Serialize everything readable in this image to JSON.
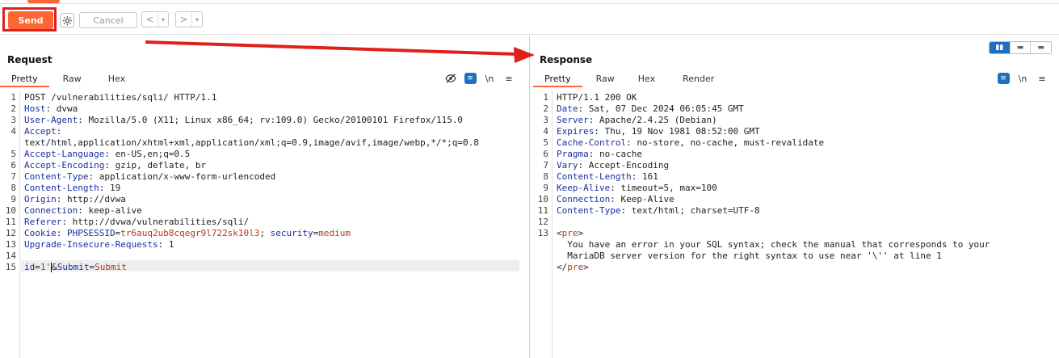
{
  "toolbar": {
    "send_label": "Send",
    "cancel_label": "Cancel",
    "back_glyph": "<",
    "forward_glyph": ">",
    "dropdown_glyph": "▾"
  },
  "request": {
    "title": "Request",
    "tabs": [
      "Pretty",
      "Raw",
      "Hex"
    ],
    "active_tab": "Pretty",
    "lines": [
      {
        "n": "1",
        "parts": [
          {
            "t": "POST /vulnerabilities/sqli/ HTTP/1.1",
            "c": "v"
          }
        ]
      },
      {
        "n": "2",
        "parts": [
          {
            "t": "Host",
            "c": "k"
          },
          {
            "t": ": dvwa",
            "c": "v"
          }
        ]
      },
      {
        "n": "3",
        "parts": [
          {
            "t": "User-Agent",
            "c": "k"
          },
          {
            "t": ": Mozilla/5.0 (X11; Linux x86_64; rv:109.0) Gecko/20100101 Firefox/115.0",
            "c": "v"
          }
        ]
      },
      {
        "n": "4",
        "parts": [
          {
            "t": "Accept",
            "c": "k"
          },
          {
            "t": ":",
            "c": "v"
          }
        ]
      },
      {
        "n": "",
        "parts": [
          {
            "t": "text/html,application/xhtml+xml,application/xml;q=0.9,image/avif,image/webp,*/*;q=0.8",
            "c": "v"
          }
        ]
      },
      {
        "n": "5",
        "parts": [
          {
            "t": "Accept-Language",
            "c": "k"
          },
          {
            "t": ": en-US,en;q=0.5",
            "c": "v"
          }
        ]
      },
      {
        "n": "6",
        "parts": [
          {
            "t": "Accept-Encoding",
            "c": "k"
          },
          {
            "t": ": gzip, deflate, br",
            "c": "v"
          }
        ]
      },
      {
        "n": "7",
        "parts": [
          {
            "t": "Content-Type",
            "c": "k"
          },
          {
            "t": ": application/x-www-form-urlencoded",
            "c": "v"
          }
        ]
      },
      {
        "n": "8",
        "parts": [
          {
            "t": "Content-Length",
            "c": "k"
          },
          {
            "t": ": 19",
            "c": "v"
          }
        ]
      },
      {
        "n": "9",
        "parts": [
          {
            "t": "Origin",
            "c": "k"
          },
          {
            "t": ": http://dvwa",
            "c": "v"
          }
        ]
      },
      {
        "n": "10",
        "parts": [
          {
            "t": "Connection",
            "c": "k"
          },
          {
            "t": ": keep-alive",
            "c": "v"
          }
        ]
      },
      {
        "n": "11",
        "parts": [
          {
            "t": "Referer",
            "c": "k"
          },
          {
            "t": ": http://dvwa/vulnerabilities/sqli/",
            "c": "v"
          }
        ]
      },
      {
        "n": "12",
        "parts": [
          {
            "t": "Cookie",
            "c": "k"
          },
          {
            "t": ": ",
            "c": "v"
          },
          {
            "t": "PHPSESSID",
            "c": "k"
          },
          {
            "t": "=",
            "c": "v"
          },
          {
            "t": "tr6auq2ub8cqegr9l722sk10l3",
            "c": "red"
          },
          {
            "t": "; ",
            "c": "v"
          },
          {
            "t": "security",
            "c": "k"
          },
          {
            "t": "=",
            "c": "v"
          },
          {
            "t": "medium",
            "c": "red"
          }
        ]
      },
      {
        "n": "13",
        "parts": [
          {
            "t": "Upgrade-Insecure-Requests",
            "c": "k"
          },
          {
            "t": ": 1",
            "c": "v"
          }
        ]
      },
      {
        "n": "14",
        "parts": []
      },
      {
        "n": "15",
        "parts": [
          {
            "t": "id",
            "c": "k"
          },
          {
            "t": "=",
            "c": "v"
          },
          {
            "t": "1'",
            "c": "red"
          },
          {
            "t": "|",
            "c": "cursor"
          },
          {
            "t": "&",
            "c": "v"
          },
          {
            "t": "Submit",
            "c": "k"
          },
          {
            "t": "=",
            "c": "v"
          },
          {
            "t": "Submit",
            "c": "red"
          }
        ]
      }
    ]
  },
  "response": {
    "title": "Response",
    "tabs": [
      "Pretty",
      "Raw",
      "Hex",
      "Render"
    ],
    "active_tab": "Pretty",
    "lines": [
      {
        "n": "1",
        "parts": [
          {
            "t": "HTTP/1.1 200 OK",
            "c": "v"
          }
        ]
      },
      {
        "n": "2",
        "parts": [
          {
            "t": "Date",
            "c": "k"
          },
          {
            "t": ": Sat, 07 Dec 2024 06:05:45 GMT",
            "c": "v"
          }
        ]
      },
      {
        "n": "3",
        "parts": [
          {
            "t": "Server",
            "c": "k"
          },
          {
            "t": ": Apache/2.4.25 (Debian)",
            "c": "v"
          }
        ]
      },
      {
        "n": "4",
        "parts": [
          {
            "t": "Expires",
            "c": "k"
          },
          {
            "t": ": Thu, 19 Nov 1981 08:52:00 GMT",
            "c": "v"
          }
        ]
      },
      {
        "n": "5",
        "parts": [
          {
            "t": "Cache-Control",
            "c": "k"
          },
          {
            "t": ": no-store, no-cache, must-revalidate",
            "c": "v"
          }
        ]
      },
      {
        "n": "6",
        "parts": [
          {
            "t": "Pragma",
            "c": "k"
          },
          {
            "t": ": no-cache",
            "c": "v"
          }
        ]
      },
      {
        "n": "7",
        "parts": [
          {
            "t": "Vary",
            "c": "k"
          },
          {
            "t": ": Accept-Encoding",
            "c": "v"
          }
        ]
      },
      {
        "n": "8",
        "parts": [
          {
            "t": "Content-Length",
            "c": "k"
          },
          {
            "t": ": 161",
            "c": "v"
          }
        ]
      },
      {
        "n": "9",
        "parts": [
          {
            "t": "Keep-Alive",
            "c": "k"
          },
          {
            "t": ": timeout=5, max=100",
            "c": "v"
          }
        ]
      },
      {
        "n": "10",
        "parts": [
          {
            "t": "Connection",
            "c": "k"
          },
          {
            "t": ": Keep-Alive",
            "c": "v"
          }
        ]
      },
      {
        "n": "11",
        "parts": [
          {
            "t": "Content-Type",
            "c": "k"
          },
          {
            "t": ": text/html; charset=UTF-8",
            "c": "v"
          }
        ]
      },
      {
        "n": "12",
        "parts": []
      },
      {
        "n": "13",
        "parts": [
          {
            "t": "<",
            "c": "v"
          },
          {
            "t": "pre",
            "c": "red"
          },
          {
            "t": ">",
            "c": "v"
          }
        ]
      },
      {
        "n": "",
        "parts": [
          {
            "t": "  You have an error in your SQL syntax; check the manual that corresponds to your",
            "c": "v"
          }
        ]
      },
      {
        "n": "",
        "parts": [
          {
            "t": "  MariaDB server version for the right syntax to use near '\\'' at line 1",
            "c": "v"
          }
        ]
      },
      {
        "n": "",
        "parts": [
          {
            "t": "</",
            "c": "v"
          },
          {
            "t": "pre",
            "c": "red"
          },
          {
            "t": ">",
            "c": "v"
          }
        ]
      }
    ]
  },
  "icons": {
    "settings": "gear-icon",
    "hide": "eye-off-icon",
    "wrap": "wrap-icon",
    "newline": "\\n",
    "menu": "menu-icon"
  },
  "colors": {
    "accent": "#ff6633",
    "highlight": "#e0201c",
    "key_blue": "#1a2fa0",
    "value_red": "#b83a18",
    "toggle_blue": "#1e6fc4"
  }
}
